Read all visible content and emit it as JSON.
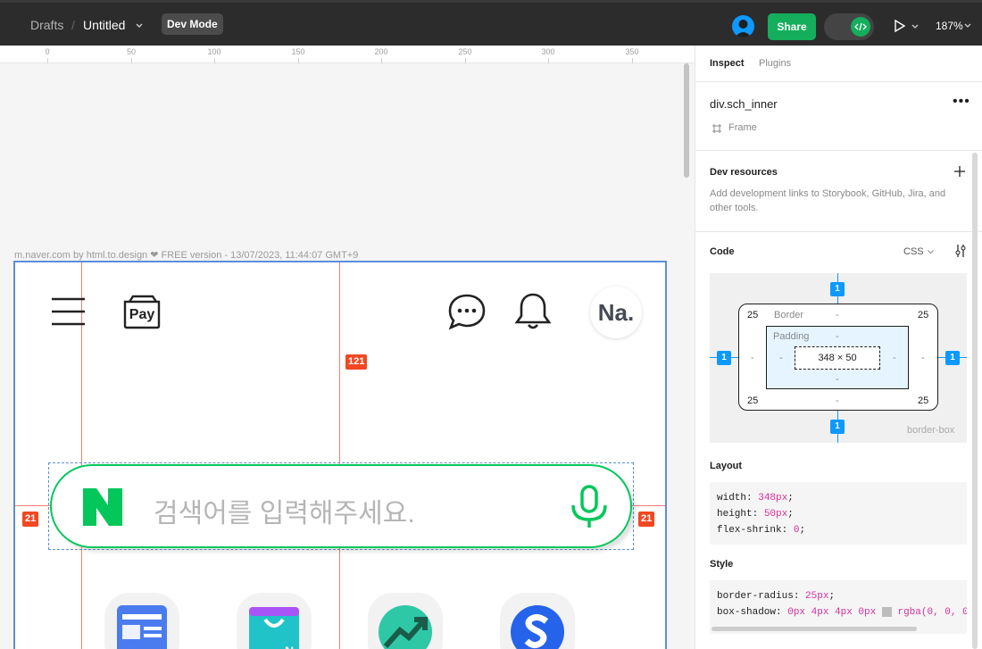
{
  "topbar": {
    "breadcrumb_parent": "Drafts",
    "breadcrumb_sep": "/",
    "file_name": "Untitled",
    "dev_mode_label": "Dev Mode",
    "share_label": "Share",
    "zoom": "187%"
  },
  "canvas": {
    "ruler_ticks": [
      "0",
      "50",
      "100",
      "150",
      "200",
      "250",
      "300",
      "350"
    ],
    "frame_label": "m.naver.com by html.to.design ❤ FREE version - 13/07/2023, 11:44:07 GMT+9",
    "measure_top": "121",
    "measure_left": "21",
    "measure_right": "21",
    "pay_label": "Pay",
    "avatar_text": "Na.",
    "search_placeholder": "검색어를 입력해주세요.",
    "brand_color": "#03c75a"
  },
  "panel": {
    "tabs": [
      "Inspect",
      "Plugins"
    ],
    "selection_name": "div.sch_inner",
    "selection_type": "Frame",
    "dev_resources_title": "Dev resources",
    "dev_resources_desc": "Add development links to Storybook, GitHub, Jira, and other tools.",
    "code_title": "Code",
    "code_lang": "CSS",
    "box_model": {
      "margin": "1",
      "border_label": "Border",
      "padding_label": "Padding",
      "radius": "25",
      "dash": "-",
      "size": "348 × 50",
      "sizing": "border-box"
    },
    "layout_title": "Layout",
    "layout_code": [
      {
        "prop": "width",
        "value": "348px"
      },
      {
        "prop": "height",
        "value": "50px"
      },
      {
        "prop": "flex-shrink",
        "value": "0"
      }
    ],
    "style_title": "Style",
    "style_code": [
      {
        "prop": "border-radius",
        "value": "25px"
      },
      {
        "prop": "box-shadow",
        "value": "0px 4px 4px 0px",
        "extra": "rgba(0, 0, 0"
      }
    ]
  }
}
